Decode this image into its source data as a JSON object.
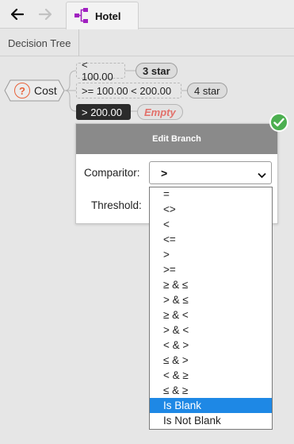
{
  "toolbar": {
    "back_icon": "arrow-left-icon",
    "forward_icon": "arrow-right-icon",
    "tab": {
      "label": "Hotel",
      "icon": "decision-tree-icon",
      "icon_color": "#a020c0"
    }
  },
  "breadcrumb": {
    "label": "Decision Tree"
  },
  "tree": {
    "root": {
      "label": "Cost",
      "icon": "question-icon"
    },
    "branches": [
      {
        "condition": "< 100.00",
        "outcome": "3 star"
      },
      {
        "condition": ">= 100.00 < 200.00",
        "outcome": "4 star"
      },
      {
        "condition": "> 200.00",
        "outcome": "Empty",
        "selected": true
      }
    ]
  },
  "edit_branch": {
    "title": "Edit Branch",
    "comparitor_label": "Comparitor:",
    "comparitor_value": ">",
    "threshold_label": "Threshold:",
    "status_icon": "check-icon",
    "options": [
      "=",
      "<>",
      "<",
      "<=",
      ">",
      ">=",
      "≥ & ≤",
      "> & ≤",
      "≥ & <",
      "> & <",
      "< & >",
      "≤ & >",
      "< & ≥",
      "≤ & ≥",
      "Is Blank",
      "Is Not Blank"
    ],
    "highlighted_option": "Is Blank"
  },
  "colors": {
    "selected_branch": "#2b2b2b",
    "empty_outcome": "#e2706a",
    "question_icon": "#e8623a",
    "ok_badge": "#4caf50",
    "dropdown_highlight": "#1e88e5"
  }
}
